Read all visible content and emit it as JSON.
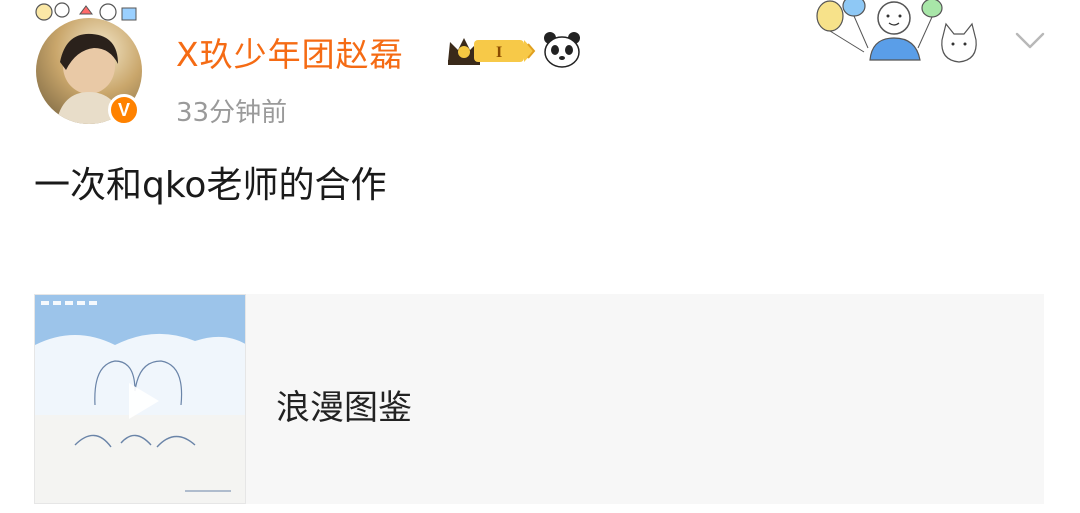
{
  "post": {
    "username": "X玖少年团赵磊",
    "level_label": "I",
    "timestamp": "33分钟前",
    "text": "一次和qko老师的合作"
  },
  "media_card": {
    "title": "浪漫图鉴"
  },
  "colors": {
    "username": "#f56b14",
    "verified": "#ff8200",
    "timestamp": "#9a9a9a",
    "card_bg": "#f7f7f7"
  },
  "icons": {
    "verified": "verified-icon",
    "vip_crown": "crown-icon",
    "panda": "panda-icon",
    "chevron": "chevron-down-icon",
    "play": "play-icon"
  }
}
